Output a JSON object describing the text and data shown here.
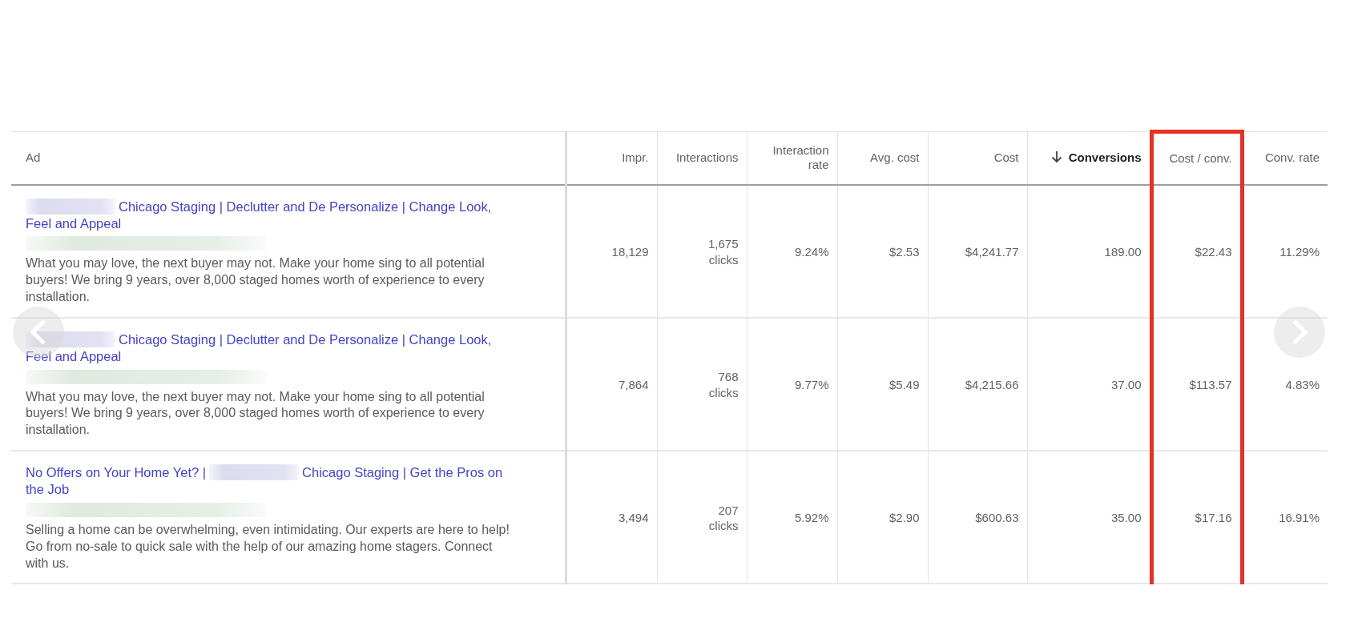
{
  "columns": [
    {
      "label": "Ad",
      "sorted": false,
      "highlighted": false
    },
    {
      "label": "Impr.",
      "sorted": false,
      "highlighted": false
    },
    {
      "label": "Interactions",
      "sorted": false,
      "highlighted": false
    },
    {
      "label": "Interaction rate",
      "sorted": false,
      "highlighted": false
    },
    {
      "label": "Avg. cost",
      "sorted": false,
      "highlighted": false
    },
    {
      "label": "Cost",
      "sorted": false,
      "highlighted": false
    },
    {
      "label": "Conversions",
      "sorted": true,
      "highlighted": false
    },
    {
      "label": "Cost / conv.",
      "sorted": false,
      "highlighted": true
    },
    {
      "label": "Conv. rate",
      "sorted": false,
      "highlighted": false
    }
  ],
  "rows": [
    {
      "headline": [
        {
          "kind": "redacted"
        },
        {
          "kind": "text",
          "text": "Chicago Staging | Declutter and De Personalize | Change Look, Feel and Appeal"
        }
      ],
      "url_redacted": true,
      "description": "What you may love, the next buyer may not. Make your home sing to all potential buyers! We bring 9 years, over 8,000 staged homes worth of experience to every installation.",
      "cells": [
        "18,129",
        "1,675 clicks",
        "9.24%",
        "$2.53",
        "$4,241.77",
        "189.00",
        "$22.43",
        "11.29%"
      ]
    },
    {
      "headline": [
        {
          "kind": "redacted"
        },
        {
          "kind": "text",
          "text": "Chicago Staging | Declutter and De Personalize | Change Look, Feel and Appeal"
        }
      ],
      "url_redacted": true,
      "description": "What you may love, the next buyer may not. Make your home sing to all potential buyers! We bring 9 years, over 8,000 staged homes worth of experience to every installation.",
      "cells": [
        "7,864",
        "768 clicks",
        "9.77%",
        "$5.49",
        "$4,215.66",
        "37.00",
        "$113.57",
        "4.83%"
      ]
    },
    {
      "headline": [
        {
          "kind": "text",
          "text": "No Offers on Your Home Yet? |"
        },
        {
          "kind": "redacted"
        },
        {
          "kind": "text",
          "text": "Chicago Staging | Get the Pros on the Job"
        }
      ],
      "url_redacted": true,
      "description": "Selling a home can be overwhelming, even intimidating. Our experts are here to help! Go from no-sale to quick sale with the help of our amazing home stagers. Connect with us.",
      "cells": [
        "3,494",
        "207 clicks",
        "5.92%",
        "$2.90",
        "$600.63",
        "35.00",
        "$17.16",
        "16.91%"
      ]
    }
  ],
  "carousel": {
    "previous": true,
    "next": true
  }
}
